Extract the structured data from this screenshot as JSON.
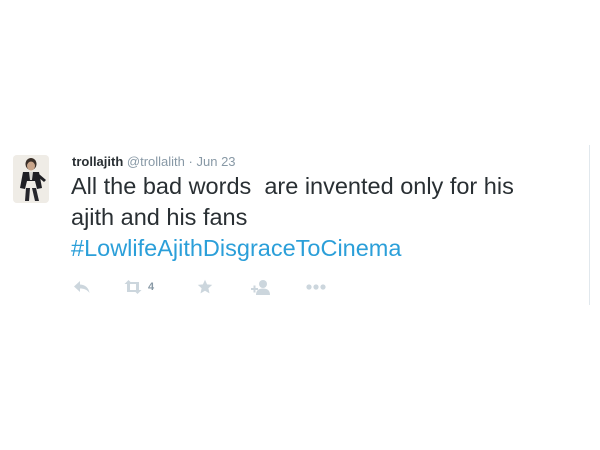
{
  "tweet": {
    "name": "trollajith",
    "handle": "@trollalith",
    "separator": "·",
    "time": "Jun 23",
    "text_line1": "All the bad words  are invented only for his",
    "text_line2": "ajith and his fans",
    "hashtag": "#LowlifeAjithDisgraceToCinema",
    "retweet_count": "4"
  },
  "actions": {
    "reply_icon": "reply-icon",
    "retweet_icon": "retweet-icon",
    "favorite_icon": "star-icon",
    "follow_icon": "add-user-icon",
    "more_icon": "more-dots-icon"
  },
  "colors": {
    "text": "#292f33",
    "muted": "#8899a6",
    "hashtag": "#2b9fd9",
    "icon": "#ccd6dd",
    "border": "#e1e8ed"
  }
}
